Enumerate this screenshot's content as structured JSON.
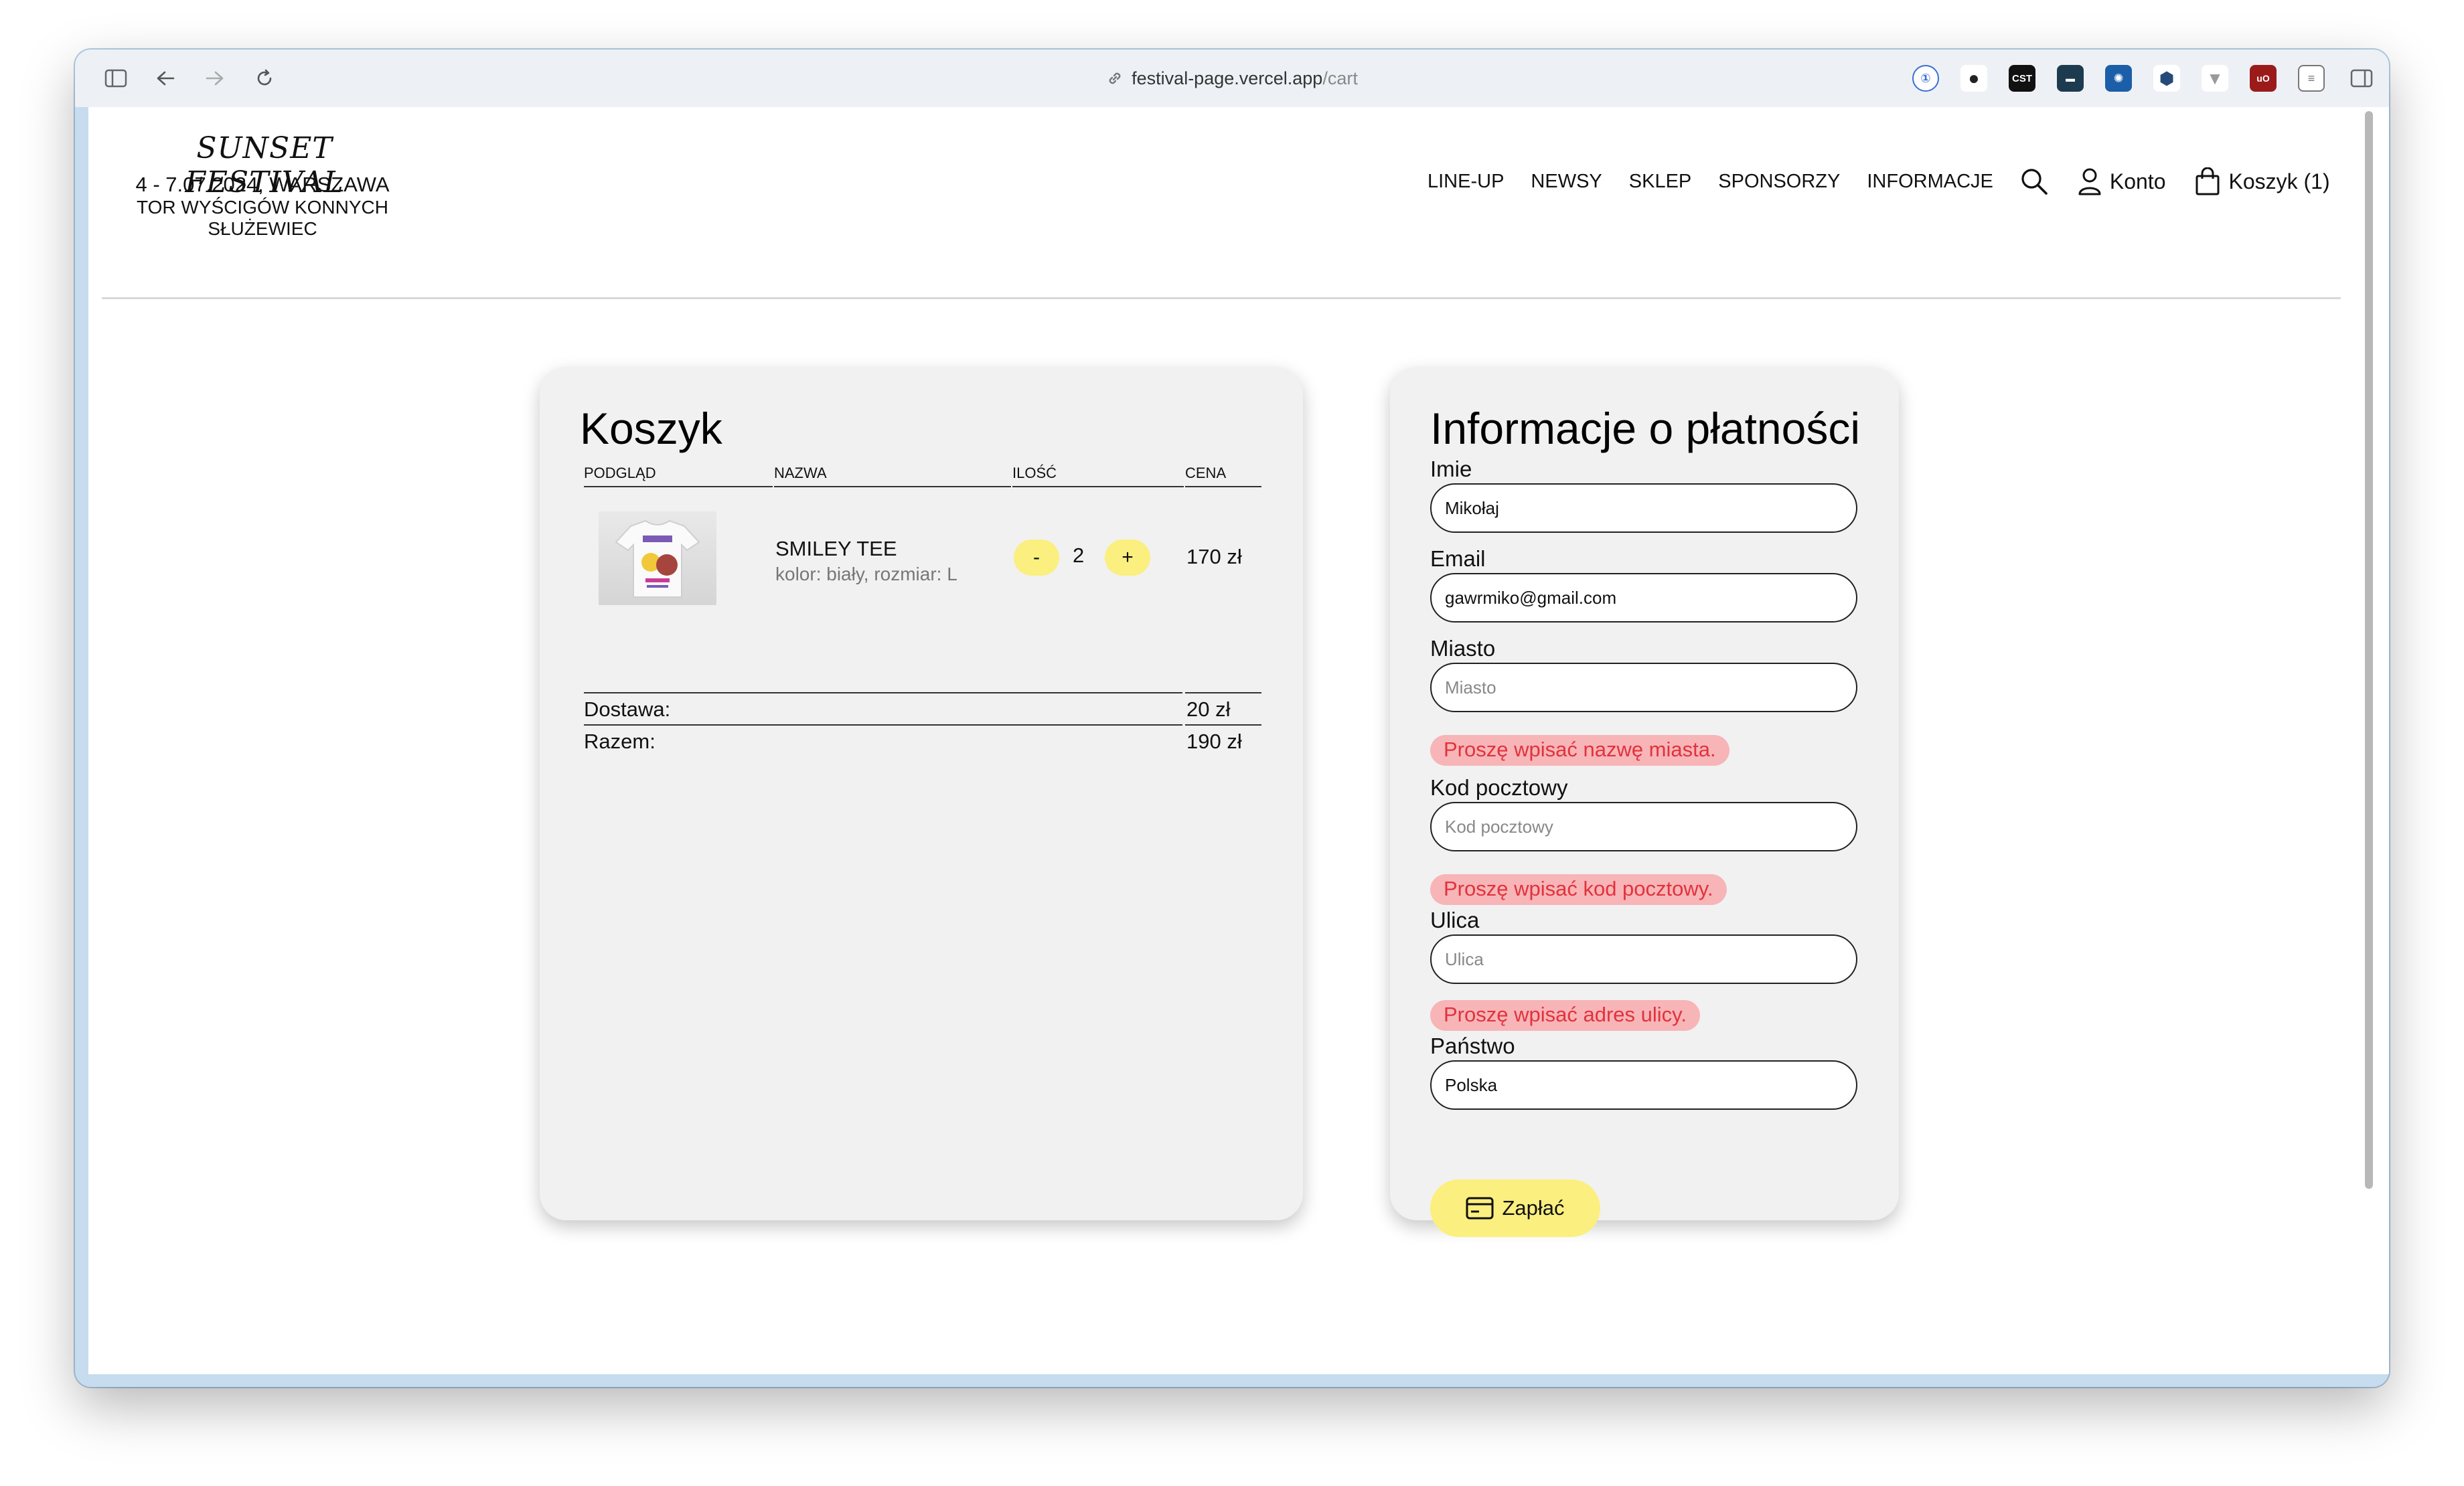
{
  "browser": {
    "url_host": "festival-page.vercel.app",
    "url_path": "/cart"
  },
  "site": {
    "logo_title": "SUNSET FESTIVAL",
    "logo_date": "4 - 7.07.2024, WARSZAWA",
    "logo_place": "TOR WYŚCIGÓW KONNYCH SŁUŻEWIEC",
    "nav": [
      "LINE-UP",
      "NEWSY",
      "SKLEP",
      "SPONSORZY",
      "INFORMACJE"
    ],
    "account_label": "Konto",
    "cart_label": "Koszyk (1)"
  },
  "cart": {
    "title": "Koszyk",
    "headers": {
      "preview": "PODGLĄD",
      "name": "NAZWA",
      "qty": "ILOŚĆ",
      "price": "CENA"
    },
    "item": {
      "name": "SMILEY TEE",
      "variant": "kolor: biały, rozmiar: L",
      "quantity": "2",
      "minus": "-",
      "plus": "+",
      "price": "170 zł"
    },
    "shipping_label": "Dostawa:",
    "shipping_value": "20 zł",
    "total_label": "Razem:",
    "total_value": "190 zł"
  },
  "payment": {
    "title": "Informacje o płatności",
    "name_label": "Imie",
    "name_value": "Mikołaj",
    "email_label": "Email",
    "email_value": "gawrmiko@gmail.com",
    "city_label": "Miasto",
    "city_placeholder": "Miasto",
    "city_error": "Proszę wpisać nazwę miasta.",
    "zip_label": "Kod pocztowy",
    "zip_placeholder": "Kod pocztowy",
    "zip_error": "Proszę wpisać kod pocztowy.",
    "street_label": "Ulica",
    "street_placeholder": "Ulica",
    "street_error": "Proszę wpisać adres ulicy.",
    "country_label": "Państwo",
    "country_value": "Polska",
    "pay_button": "Zapłać"
  },
  "colors": {
    "accent_yellow": "#fbef7f",
    "error_bg": "#f7b5b8",
    "error_text": "#e2323c",
    "footer": "#222222"
  }
}
